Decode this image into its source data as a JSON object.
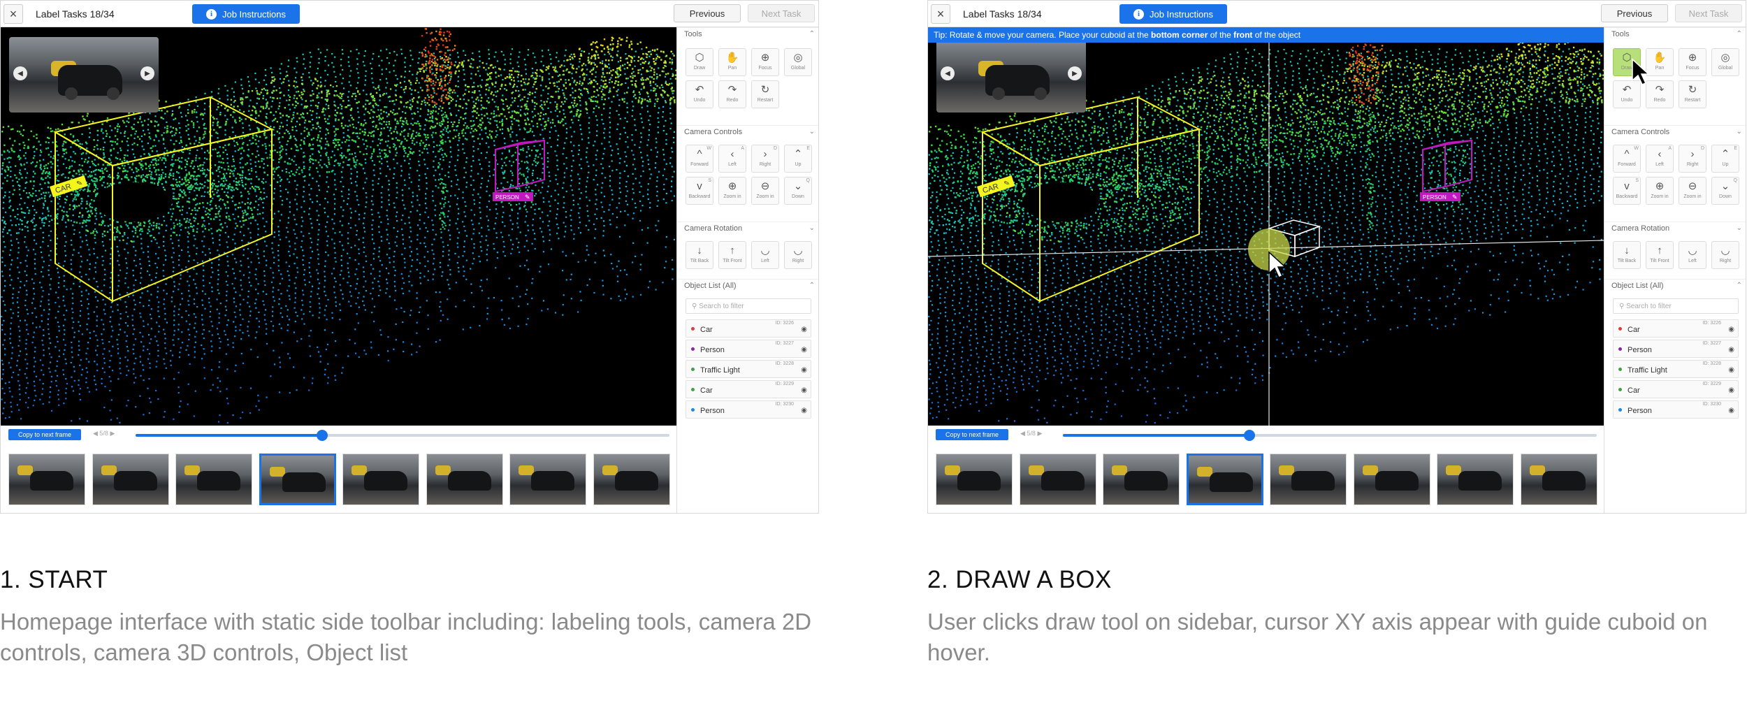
{
  "panels": [
    {
      "title_bar": {
        "task": "Label Tasks 18/34",
        "job_button": "Job Instructions",
        "previous": "Previous",
        "next": "Next Task",
        "close": "×"
      },
      "tip": "",
      "sections": {
        "tools": "Tools",
        "camera_controls": "Camera Controls",
        "camera_rotation": "Camera Rotation",
        "object_list": "Object List (All)"
      },
      "tools": [
        {
          "label": "Draw",
          "icon": "cube-icon",
          "glyph": "⬡"
        },
        {
          "label": "Pan",
          "icon": "hand-icon",
          "glyph": "✋"
        },
        {
          "label": "Focus",
          "icon": "focus-icon",
          "glyph": "⊕"
        },
        {
          "label": "Global",
          "icon": "globe-icon",
          "glyph": "◎"
        },
        {
          "label": "Undo",
          "icon": "undo-icon",
          "glyph": "↶"
        },
        {
          "label": "Redo",
          "icon": "redo-icon",
          "glyph": "↷"
        },
        {
          "label": "Restart",
          "icon": "restart-icon",
          "glyph": "↻"
        }
      ],
      "camera_controls": [
        {
          "label": "Forward",
          "key": "W",
          "glyph": "^",
          "icon": "forward-icon"
        },
        {
          "label": "Left",
          "key": "A",
          "glyph": "‹",
          "icon": "left-icon"
        },
        {
          "label": "Right",
          "key": "D",
          "glyph": "›",
          "icon": "right-icon"
        },
        {
          "label": "Up",
          "key": "E",
          "glyph": "⌃",
          "icon": "up-icon"
        },
        {
          "label": "Backward",
          "key": "S",
          "glyph": "v",
          "icon": "backward-icon"
        },
        {
          "label": "Zoom in",
          "key": "",
          "glyph": "⊕",
          "icon": "zoom-in-icon"
        },
        {
          "label": "Zoom in",
          "key": "",
          "glyph": "⊖",
          "icon": "zoom-out-icon"
        },
        {
          "label": "Down",
          "key": "Q",
          "glyph": "⌄",
          "icon": "down-icon"
        }
      ],
      "camera_rotation": [
        {
          "label": "Tilt Back",
          "glyph": "↓",
          "icon": "tilt-back-icon"
        },
        {
          "label": "Tilt Front",
          "glyph": "↑",
          "icon": "tilt-front-icon"
        },
        {
          "label": "Left",
          "glyph": "◡",
          "icon": "rotate-left-icon"
        },
        {
          "label": "Right",
          "glyph": "◡",
          "icon": "rotate-right-icon"
        }
      ],
      "search_placeholder": "Search to filter",
      "objects": [
        {
          "name": "Car",
          "id": "ID: 3226",
          "color": "#e53935"
        },
        {
          "name": "Person",
          "id": "ID: 3227",
          "color": "#8e24aa"
        },
        {
          "name": "Traffic Light",
          "id": "ID: 3228",
          "color": "#43a047"
        },
        {
          "name": "Car",
          "id": "ID: 3229",
          "color": "#43a047"
        },
        {
          "name": "Person",
          "id": "ID: 3230",
          "color": "#1e88e5"
        }
      ],
      "copy_button": "Copy to next frame",
      "frame_counter": "5/8",
      "progress": 0.35,
      "labels": {
        "car": "CAR",
        "person": "PERSON"
      },
      "selected_frame": 3
    },
    {
      "title_bar": {
        "task": "Label Tasks 18/34",
        "job_button": "Job Instructions",
        "previous": "Previous",
        "next": "Next Task",
        "close": "×"
      },
      "tip": {
        "pre": "Tip: Rotate & move your camera. Place your cuboid at the ",
        "b1": "bottom corner",
        "mid": " of the ",
        "b2": "front",
        "post": " of the object"
      },
      "sections": {
        "tools": "Tools",
        "camera_controls": "Camera Controls",
        "camera_rotation": "Camera Rotation",
        "object_list": "Object List (All)"
      },
      "tools": [
        {
          "label": "Draw",
          "icon": "cube-icon",
          "glyph": "⬡"
        },
        {
          "label": "Pan",
          "icon": "hand-icon",
          "glyph": "✋"
        },
        {
          "label": "Focus",
          "icon": "focus-icon",
          "glyph": "⊕"
        },
        {
          "label": "Global",
          "icon": "globe-icon",
          "glyph": "◎"
        },
        {
          "label": "Undo",
          "icon": "undo-icon",
          "glyph": "↶"
        },
        {
          "label": "Redo",
          "icon": "redo-icon",
          "glyph": "↷"
        },
        {
          "label": "Restart",
          "icon": "restart-icon",
          "glyph": "↻"
        }
      ],
      "camera_controls": [
        {
          "label": "Forward",
          "key": "W",
          "glyph": "^",
          "icon": "forward-icon"
        },
        {
          "label": "Left",
          "key": "A",
          "glyph": "‹",
          "icon": "left-icon"
        },
        {
          "label": "Right",
          "key": "D",
          "glyph": "›",
          "icon": "right-icon"
        },
        {
          "label": "Up",
          "key": "E",
          "glyph": "⌃",
          "icon": "up-icon"
        },
        {
          "label": "Backward",
          "key": "S",
          "glyph": "v",
          "icon": "backward-icon"
        },
        {
          "label": "Zoom in",
          "key": "",
          "glyph": "⊕",
          "icon": "zoom-in-icon"
        },
        {
          "label": "Zoom in",
          "key": "",
          "glyph": "⊖",
          "icon": "zoom-out-icon"
        },
        {
          "label": "Down",
          "key": "Q",
          "glyph": "⌄",
          "icon": "down-icon"
        }
      ],
      "camera_rotation": [
        {
          "label": "Tilt Back",
          "glyph": "↓",
          "icon": "tilt-back-icon"
        },
        {
          "label": "Tilt Front",
          "glyph": "↑",
          "icon": "tilt-front-icon"
        },
        {
          "label": "Left",
          "glyph": "◡",
          "icon": "rotate-left-icon"
        },
        {
          "label": "Right",
          "glyph": "◡",
          "icon": "rotate-right-icon"
        }
      ],
      "search_placeholder": "Search to filter",
      "objects": [
        {
          "name": "Car",
          "id": "ID: 3226",
          "color": "#e53935"
        },
        {
          "name": "Person",
          "id": "ID: 3227",
          "color": "#8e24aa"
        },
        {
          "name": "Traffic Light",
          "id": "ID: 3228",
          "color": "#43a047"
        },
        {
          "name": "Car",
          "id": "ID: 3229",
          "color": "#43a047"
        },
        {
          "name": "Person",
          "id": "ID: 3230",
          "color": "#1e88e5"
        }
      ],
      "copy_button": "Copy to next frame",
      "frame_counter": "5/8",
      "progress": 0.35,
      "labels": {
        "car": "CAR",
        "person": "PERSON"
      },
      "selected_frame": 3
    }
  ],
  "captions": [
    {
      "title": "1. START",
      "body": "Homepage interface with static side toolbar including: labeling tools, camera 2D controls, camera 3D controls, Object list"
    },
    {
      "title": "2. DRAW A BOX",
      "body": "User clicks draw tool on sidebar, cursor XY axis appear with guide cuboid on hover."
    }
  ],
  "colors": {
    "accent": "#1a73e8",
    "car_box": "#f5f51e",
    "person_box": "#c218c2",
    "highlight": "#c8d84a"
  }
}
